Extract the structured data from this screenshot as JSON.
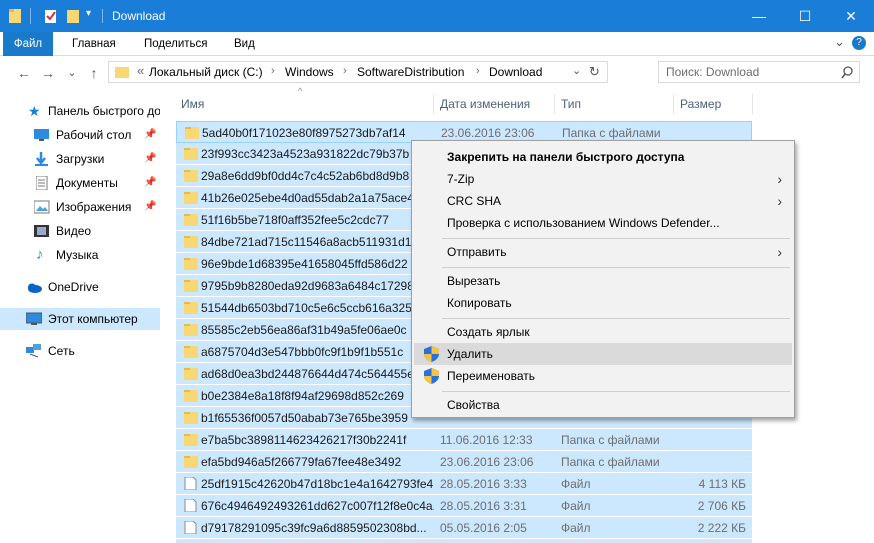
{
  "window": {
    "title": "Download",
    "minimize": "—",
    "maximize": "☐",
    "close": "✕",
    "accent": "#1a7dd7"
  },
  "ribbon": {
    "tabs": [
      "Файл",
      "Главная",
      "Поделиться",
      "Вид"
    ],
    "expand": "⌄",
    "help": "?"
  },
  "address": {
    "back": "←",
    "forward": "→",
    "recent": "⌄",
    "up": "↑",
    "overflow": "«",
    "crumbs": [
      "Локальный диск (C:)",
      "Windows",
      "SoftwareDistribution",
      "Download"
    ],
    "sep": "›",
    "dropdown": "⌄",
    "refresh": "↻"
  },
  "search": {
    "placeholder": "Поиск: Download",
    "icon": "search-icon"
  },
  "nav": {
    "quick_access": "Панель быстрого доступа",
    "items": [
      {
        "label": "Рабочий стол",
        "icon": "desktop-icon",
        "pinned": true
      },
      {
        "label": "Загрузки",
        "icon": "downloads-icon",
        "pinned": true
      },
      {
        "label": "Документы",
        "icon": "documents-icon",
        "pinned": true
      },
      {
        "label": "Изображения",
        "icon": "pictures-icon",
        "pinned": true
      },
      {
        "label": "Видео",
        "icon": "video-icon",
        "pinned": false
      },
      {
        "label": "Музыка",
        "icon": "music-icon",
        "pinned": false
      }
    ],
    "onedrive": "OneDrive",
    "this_pc": "Этот компьютер",
    "network": "Сеть"
  },
  "columns": {
    "name": "Имя",
    "date": "Дата изменения",
    "type": "Тип",
    "size": "Размер"
  },
  "files": [
    {
      "name": "5ad40b0f171023e80f8975273db7af14",
      "date": "23.06.2016 23:06",
      "type": "Папка с файлами",
      "size": "",
      "folder": true
    },
    {
      "name": "23f993cc3423a4523a931822dc79b37b",
      "date": "",
      "type": "",
      "size": "",
      "folder": true
    },
    {
      "name": "29a8e6dd9bf0dd4c7c4c52ab6bd8d9b8",
      "date": "",
      "type": "",
      "size": "",
      "folder": true
    },
    {
      "name": "41b26e025ebe4d0ad55dab2a1a75ace4",
      "date": "",
      "type": "",
      "size": "",
      "folder": true
    },
    {
      "name": "51f16b5be718f0aff352fee5c2cdc77",
      "date": "",
      "type": "",
      "size": "",
      "folder": true
    },
    {
      "name": "84dbe721ad715c11546a8acb511931d1",
      "date": "",
      "type": "",
      "size": "",
      "folder": true
    },
    {
      "name": "96e9bde1d68395e41658045ffd586d22",
      "date": "",
      "type": "",
      "size": "",
      "folder": true
    },
    {
      "name": "9795b9b8280eda92d9683a6484c17298",
      "date": "",
      "type": "",
      "size": "",
      "folder": true
    },
    {
      "name": "51544db6503bd710c5e6c5ccb616a325",
      "date": "",
      "type": "",
      "size": "",
      "folder": true
    },
    {
      "name": "85585c2eb56ea86af31b49a5fe06ae0c",
      "date": "",
      "type": "",
      "size": "",
      "folder": true
    },
    {
      "name": "a6875704d3e547bbb0fc9f1b9f1b551c",
      "date": "",
      "type": "",
      "size": "",
      "folder": true
    },
    {
      "name": "ad68d0ea3bd244876644d474c564455e",
      "date": "",
      "type": "",
      "size": "",
      "folder": true
    },
    {
      "name": "b0e2384e8a18f8f94af29698d852c269",
      "date": "",
      "type": "",
      "size": "",
      "folder": true
    },
    {
      "name": "b1f65536f0057d50abab73e765be3959",
      "date": "",
      "type": "",
      "size": "",
      "folder": true
    },
    {
      "name": "e7ba5bc3898114623426217f30b2241f",
      "date": "11.06.2016 12:33",
      "type": "Папка с файлами",
      "size": "",
      "folder": true
    },
    {
      "name": "efa5bd946a5f266779fa67fee48e3492",
      "date": "23.06.2016 23:06",
      "type": "Папка с файлами",
      "size": "",
      "folder": true
    },
    {
      "name": "25df1915c42620b47d18bc1e4a1642793fe4...",
      "date": "28.05.2016 3:33",
      "type": "Файл",
      "size": "4 113 КБ",
      "folder": false
    },
    {
      "name": "676c4946492493261dd627c007f12f8e0c4a...",
      "date": "28.05.2016 3:31",
      "type": "Файл",
      "size": "2 706 КБ",
      "folder": false
    },
    {
      "name": "d79178291095c39fc9a6d8859502308bd...",
      "date": "05.05.2016 2:05",
      "type": "Файл",
      "size": "2 222 КБ",
      "folder": false
    },
    {
      "name": "f06e6ac86e8441289f97705bf834df0a0008b...",
      "date": "11.06.2016 12:33",
      "type": "Файл",
      "size": "5 521 КБ",
      "folder": false
    }
  ],
  "context_menu": {
    "pin": "Закрепить на панели быстрого доступа",
    "zip": "7-Zip",
    "crc": "CRC SHA",
    "defender": "Проверка с использованием Windows Defender...",
    "send_to": "Отправить",
    "cut": "Вырезать",
    "copy": "Копировать",
    "shortcut": "Создать ярлык",
    "delete": "Удалить",
    "rename": "Переименовать",
    "properties": "Свойства",
    "submenu_arrow": "›"
  }
}
